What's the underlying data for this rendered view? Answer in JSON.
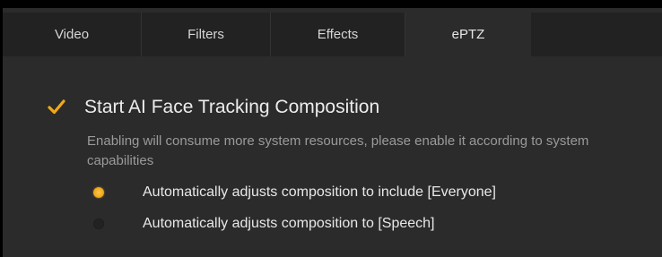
{
  "tabs": [
    {
      "label": "Video",
      "active": false
    },
    {
      "label": "Filters",
      "active": false
    },
    {
      "label": "Effects",
      "active": false
    },
    {
      "label": "ePTZ",
      "active": true
    }
  ],
  "face_tracking": {
    "label": "Start AI Face Tracking Composition",
    "checked": true,
    "description": "Enabling will consume more system resources, please enable it according to system capabilities"
  },
  "composition_options": [
    {
      "label": "Automatically adjusts composition to include [Everyone]",
      "selected": true
    },
    {
      "label": "Automatically adjusts composition to [Speech]",
      "selected": false
    }
  ],
  "colors": {
    "accent": "#f0a81a",
    "panel_bg": "#2b2b2b",
    "tabbar_bg": "#222222"
  }
}
